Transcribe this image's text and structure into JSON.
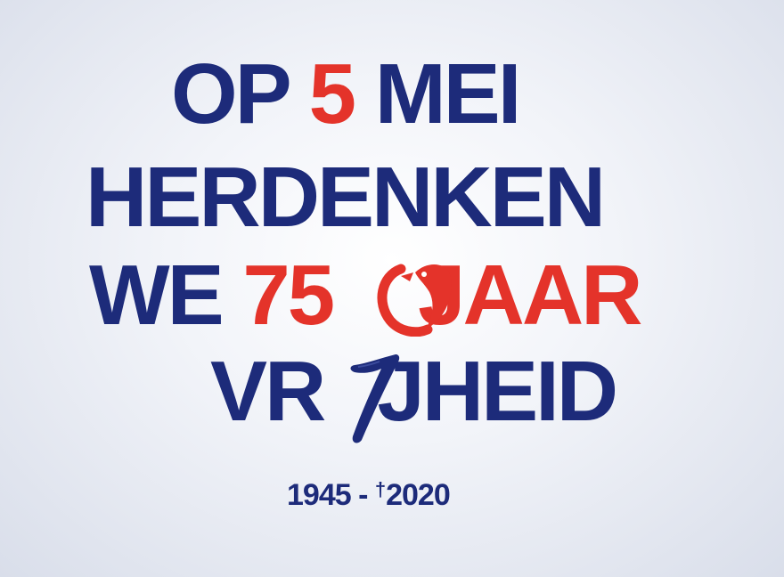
{
  "headline": {
    "line1": {
      "prefix": "OP ",
      "number": "5",
      "suffix": " MEI"
    },
    "line2": {
      "text": "HERDENKEN"
    },
    "line3": {
      "prefix": "WE ",
      "number": "75",
      "suffix": "JAAR"
    },
    "line4": {
      "left": "VR",
      "right": "JHEID"
    }
  },
  "years": {
    "start": "1945 -",
    "dagger": "†",
    "end": "2020"
  },
  "emblems": [
    "dove-logo-icon",
    "brush-one-icon"
  ],
  "colors": {
    "blue": "#1d2b7a",
    "red": "#e4332a",
    "background": "#eef1f7"
  }
}
